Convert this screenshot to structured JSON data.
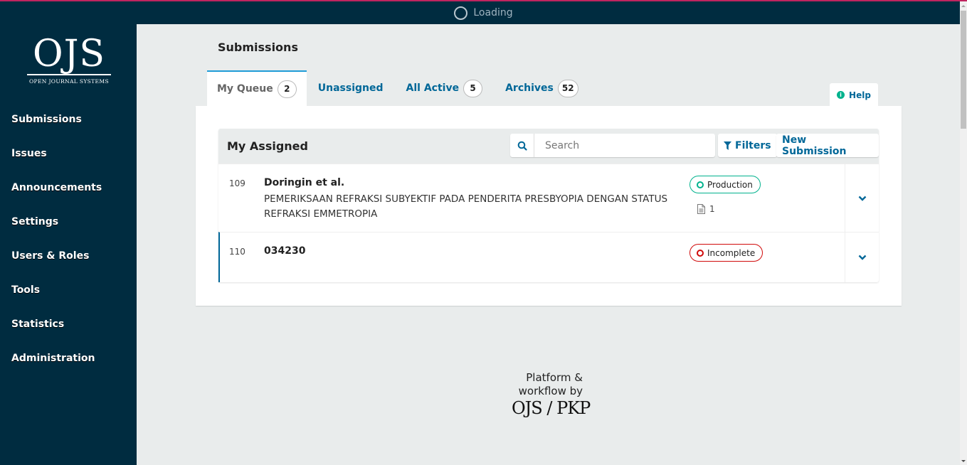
{
  "topbar": {
    "loading_label": "Loading"
  },
  "logo": {
    "title": "OJS",
    "subtitle": "OPEN JOURNAL SYSTEMS"
  },
  "sidebar": {
    "items": [
      {
        "label": "Submissions"
      },
      {
        "label": "Issues"
      },
      {
        "label": "Announcements"
      },
      {
        "label": "Settings"
      },
      {
        "label": "Users & Roles"
      },
      {
        "label": "Tools"
      },
      {
        "label": "Statistics"
      },
      {
        "label": "Administration"
      }
    ]
  },
  "main": {
    "page_title": "Submissions",
    "tabs": [
      {
        "label": "My Queue",
        "count": "2",
        "active": true
      },
      {
        "label": "Unassigned"
      },
      {
        "label": "All Active",
        "count": "5"
      },
      {
        "label": "Archives",
        "count": "52"
      }
    ],
    "help_label": "Help",
    "list": {
      "title": "My Assigned",
      "search_placeholder": "Search",
      "search_value": "",
      "filters_label": "Filters",
      "new_submission_label": "New Submission",
      "items": [
        {
          "id": "109",
          "author": "Doringin et al.",
          "title": "PEMERIKSAAN REFRAKSI SUBYEKTIF PADA PENDERITA PRESBYOPIA DENGAN STATUS REFRAKSI EMMETROPIA",
          "status": "Production",
          "status_color": "#00b28d",
          "files_count": "1"
        },
        {
          "id": "110",
          "author": "034230",
          "title": "",
          "status": "Incomplete",
          "status_color": "#d00a0a"
        }
      ]
    }
  },
  "footer": {
    "line1": "Platform &",
    "line2": "workflow by",
    "brand": "OJS / PKP"
  },
  "colors": {
    "sidebar_bg": "#002c40",
    "accent": "#006798",
    "tab_active_border": "#1e9bd7",
    "top_stripe": "#c0245f"
  }
}
